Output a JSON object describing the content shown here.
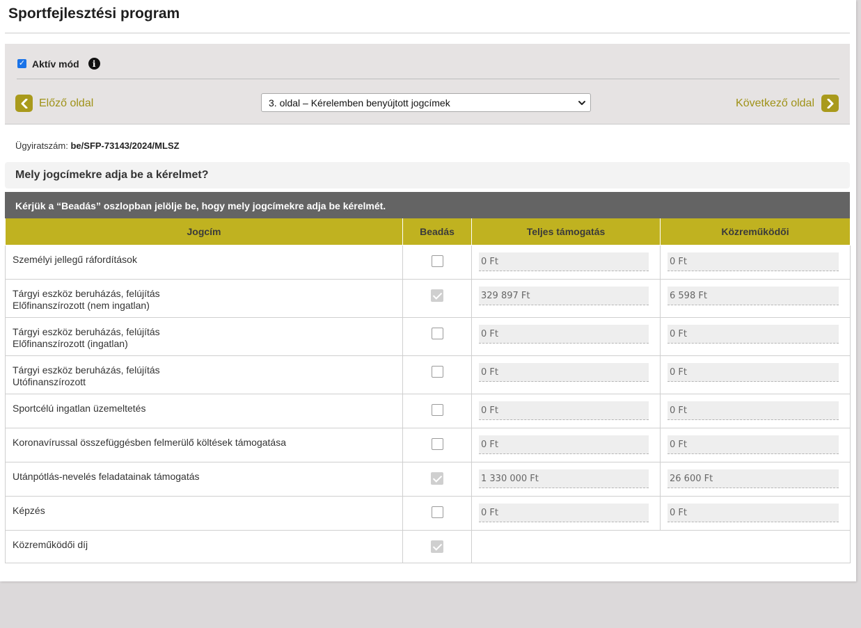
{
  "page": {
    "title": "Sportfejlesztési program"
  },
  "toolbar": {
    "aktiv_label": "Aktív mód",
    "aktiv_checked": true,
    "prev_label": "Előző oldal",
    "next_label": "Következő oldal",
    "page_select_value": "3. oldal – Kérelemben benyújtott jogcímek"
  },
  "case": {
    "label": "Ügyiratszám:",
    "number": "be/SFP-73143/2024/MLSZ"
  },
  "section": {
    "question": "Mely jogcímekre adja be a kérelmet?",
    "instruction": "Kérjük a “Beadás” oszlopban jelölje be, hogy mely jogcímekre adja be kérelmét."
  },
  "table": {
    "headers": [
      "Jogcím",
      "Beadás",
      "Teljes támogatás",
      "Közreműködői"
    ],
    "rows": [
      {
        "line1": "Személyi jellegű ráfordítások",
        "line2": "",
        "checked": false,
        "total": "0 Ft",
        "fee": "0 Ft"
      },
      {
        "line1": "Tárgyi eszköz beruházás, felújítás",
        "line2": "Előfinanszírozott (nem ingatlan)",
        "checked": true,
        "total": "329 897 Ft",
        "fee": "6 598 Ft"
      },
      {
        "line1": "Tárgyi eszköz beruházás, felújítás",
        "line2": "Előfinanszírozott (ingatlan)",
        "checked": false,
        "total": "0 Ft",
        "fee": "0 Ft"
      },
      {
        "line1": "Tárgyi eszköz beruházás, felújítás",
        "line2": "Utófinanszírozott",
        "checked": false,
        "total": "0 Ft",
        "fee": "0 Ft"
      },
      {
        "line1": "Sportcélú ingatlan üzemeltetés",
        "line2": "",
        "checked": false,
        "total": "0 Ft",
        "fee": "0 Ft"
      },
      {
        "line1": "Koronavírussal összefüggésben felmerülő költések támogatása",
        "line2": "",
        "checked": false,
        "total": "0 Ft",
        "fee": "0 Ft"
      },
      {
        "line1": "Utánpótlás-nevelés feladatainak támogatás",
        "line2": "",
        "checked": true,
        "total": "1 330 000 Ft",
        "fee": "26 600 Ft"
      },
      {
        "line1": "Képzés",
        "line2": "",
        "checked": false,
        "total": "0 Ft",
        "fee": "0 Ft"
      },
      {
        "line1": "Közreműködői díj",
        "line2": "",
        "checked": true,
        "total": "",
        "fee": ""
      }
    ]
  },
  "colors": {
    "accent": "#c0b220",
    "nav_text": "#9f9218",
    "instruction_bg": "#646464",
    "panel_bg": "#e6e3e3"
  }
}
